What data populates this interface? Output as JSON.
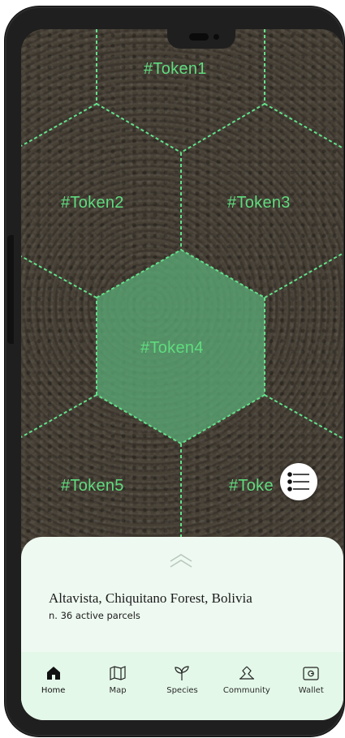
{
  "map": {
    "tokens": [
      {
        "label": "#Token1"
      },
      {
        "label": "#Token2"
      },
      {
        "label": "#Token3"
      },
      {
        "label": "#Token4"
      },
      {
        "label": "#Token5"
      },
      {
        "label": "#Toke"
      }
    ],
    "selected_token": "#Token4",
    "colors": {
      "grid": "#63e08a",
      "selected_fill": "#5aa874"
    }
  },
  "fab": {
    "icon": "list-icon"
  },
  "sheet": {
    "handle_icon": "double-chevron-up-icon",
    "location": "Altavista, Chiquitano Forest, Bolivia",
    "parcels": "n. 36 active parcels"
  },
  "nav": {
    "items": [
      {
        "label": "Home",
        "icon": "home-icon"
      },
      {
        "label": "Map",
        "icon": "map-icon"
      },
      {
        "label": "Species",
        "icon": "sprout-icon"
      },
      {
        "label": "Community",
        "icon": "community-icon"
      },
      {
        "label": "Wallet",
        "icon": "wallet-icon"
      }
    ],
    "active": "Home"
  }
}
